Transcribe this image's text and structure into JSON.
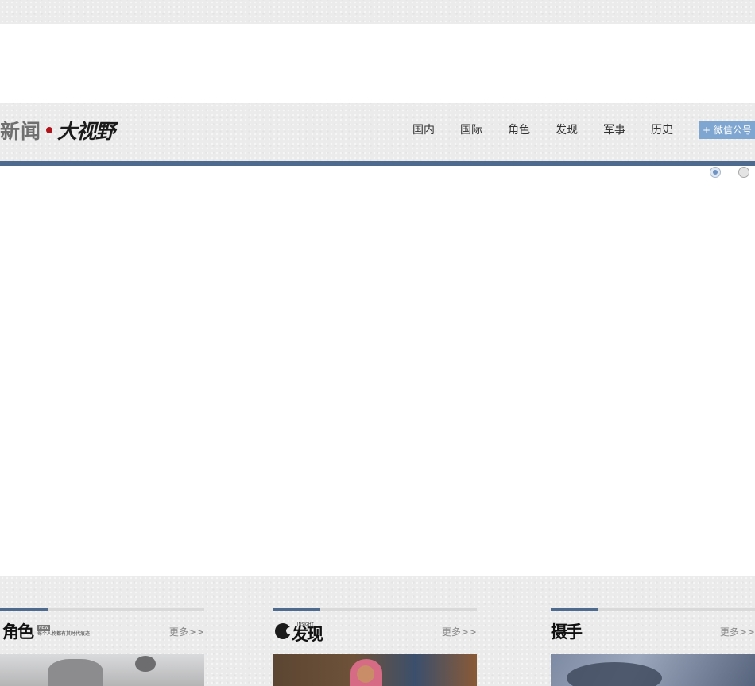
{
  "header": {
    "logo_part1": "新闻",
    "logo_part2": "大视野",
    "nav": [
      {
        "label": "国内"
      },
      {
        "label": "国际"
      },
      {
        "label": "角色"
      },
      {
        "label": "发现"
      },
      {
        "label": "军事"
      },
      {
        "label": "历史"
      }
    ],
    "wechat_label": "+ 微信公号"
  },
  "slider": {
    "dot_count": 2,
    "active_index": 0
  },
  "sections": [
    {
      "title": "角色",
      "badge": "NEW",
      "tagline": "每个人物都有其时代痕迹",
      "more_label": "更多>>"
    },
    {
      "title": "发现",
      "subtitle": "INSIGHT",
      "more_label": "更多>>"
    },
    {
      "title": "摄手",
      "more_label": "更多>>"
    }
  ],
  "colors": {
    "accent": "#4e6a8e",
    "wechat_button": "#7fa6d1",
    "logo_dot": "#b0141a"
  }
}
